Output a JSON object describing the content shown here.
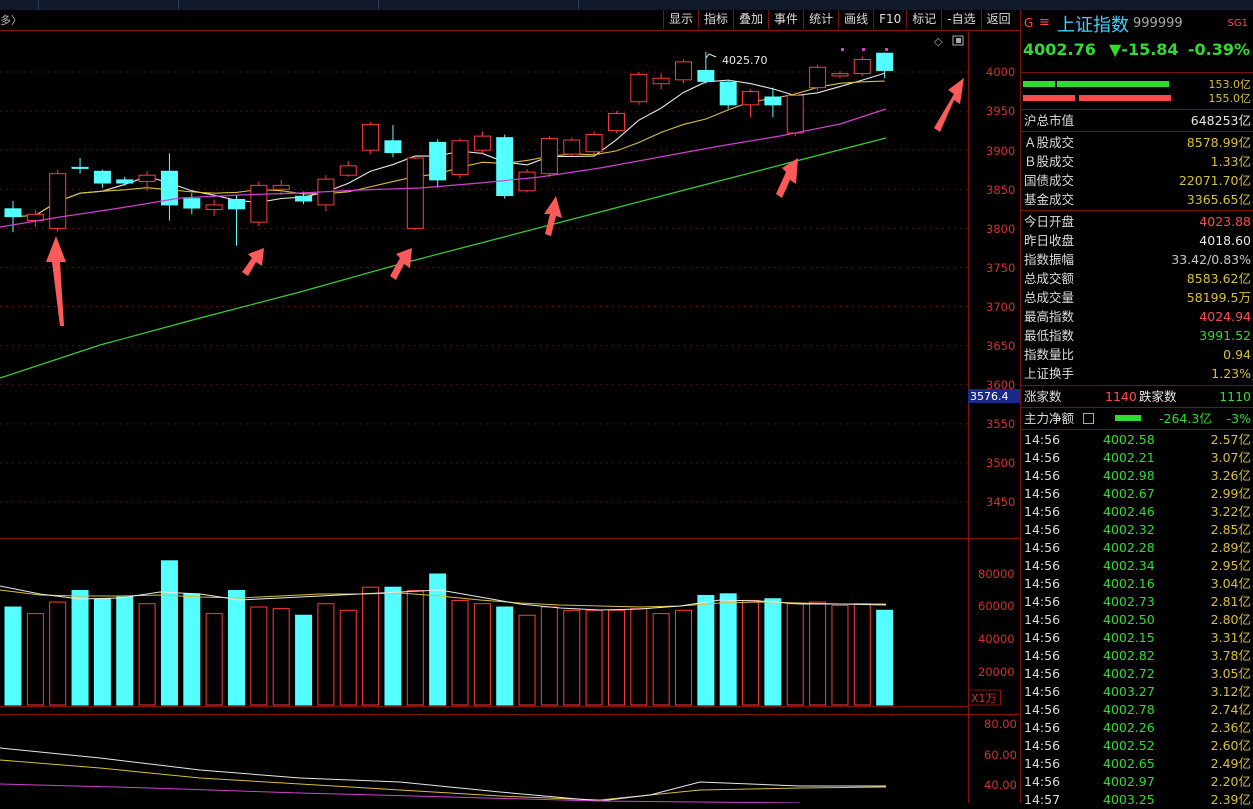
{
  "crumb": "多〉",
  "toolbar": [
    "显示",
    "指标",
    "叠加",
    "事件",
    "统计",
    "画线",
    "F10",
    "标记",
    "-自选",
    "返回"
  ],
  "price_axis": {
    "ticks": [
      "4000",
      "3950",
      "3900",
      "3850",
      "3800",
      "3750",
      "3700",
      "3650",
      "3600",
      "3550",
      "3500",
      "3450"
    ],
    "highlight": "3576.4",
    "peak_label": "4025.70"
  },
  "vol_axis": {
    "ticks": [
      "80000",
      "60000",
      "40000",
      "20000"
    ],
    "unit": "X1万"
  },
  "ind_axis": {
    "ticks": [
      "80.00",
      "60.00",
      "40.00"
    ]
  },
  "chart_data": {
    "type": "candlestick",
    "price_range": [
      3400,
      4060
    ],
    "candles": [
      {
        "o": 3825,
        "c": 3815,
        "h": 3835,
        "l": 3795
      },
      {
        "o": 3810,
        "c": 3818,
        "h": 3824,
        "l": 3802
      },
      {
        "o": 3800,
        "c": 3870,
        "h": 3875,
        "l": 3796
      },
      {
        "o": 3878,
        "c": 3877,
        "h": 3890,
        "l": 3870
      },
      {
        "o": 3873,
        "c": 3858,
        "h": 3875,
        "l": 3852
      },
      {
        "o": 3862,
        "c": 3858,
        "h": 3866,
        "l": 3855
      },
      {
        "o": 3860,
        "c": 3868,
        "h": 3873,
        "l": 3848
      },
      {
        "o": 3873,
        "c": 3830,
        "h": 3896,
        "l": 3810
      },
      {
        "o": 3838,
        "c": 3826,
        "h": 3845,
        "l": 3818
      },
      {
        "o": 3824,
        "c": 3830,
        "h": 3837,
        "l": 3816
      },
      {
        "o": 3837,
        "c": 3825,
        "h": 3842,
        "l": 3778
      },
      {
        "o": 3808,
        "c": 3855,
        "h": 3860,
        "l": 3803
      },
      {
        "o": 3850,
        "c": 3855,
        "h": 3862,
        "l": 3843
      },
      {
        "o": 3841,
        "c": 3835,
        "h": 3847,
        "l": 3831
      },
      {
        "o": 3830,
        "c": 3863,
        "h": 3868,
        "l": 3822
      },
      {
        "o": 3868,
        "c": 3880,
        "h": 3886,
        "l": 3866
      },
      {
        "o": 3900,
        "c": 3933,
        "h": 3936,
        "l": 3895
      },
      {
        "o": 3912,
        "c": 3897,
        "h": 3932,
        "l": 3891
      },
      {
        "o": 3800,
        "c": 3890,
        "h": 3894,
        "l": 3798
      },
      {
        "o": 3910,
        "c": 3862,
        "h": 3914,
        "l": 3852
      },
      {
        "o": 3869,
        "c": 3912,
        "h": 3915,
        "l": 3864
      },
      {
        "o": 3900,
        "c": 3918,
        "h": 3924,
        "l": 3895
      },
      {
        "o": 3916,
        "c": 3842,
        "h": 3920,
        "l": 3838
      },
      {
        "o": 3848,
        "c": 3872,
        "h": 3876,
        "l": 3846
      },
      {
        "o": 3870,
        "c": 3915,
        "h": 3918,
        "l": 3866
      },
      {
        "o": 3895,
        "c": 3913,
        "h": 3916,
        "l": 3892
      },
      {
        "o": 3898,
        "c": 3920,
        "h": 3924,
        "l": 3895
      },
      {
        "o": 3925,
        "c": 3947,
        "h": 3950,
        "l": 3922
      },
      {
        "o": 3962,
        "c": 3997,
        "h": 4000,
        "l": 3958
      },
      {
        "o": 3985,
        "c": 3992,
        "h": 3998,
        "l": 3978
      },
      {
        "o": 3990,
        "c": 4013,
        "h": 4016,
        "l": 3986
      },
      {
        "o": 4002,
        "c": 3988,
        "h": 4026,
        "l": 3985
      },
      {
        "o": 3987,
        "c": 3958,
        "h": 3990,
        "l": 3953
      },
      {
        "o": 3958,
        "c": 3975,
        "h": 3978,
        "l": 3942
      },
      {
        "o": 3968,
        "c": 3958,
        "h": 3980,
        "l": 3942
      },
      {
        "o": 3922,
        "c": 3970,
        "h": 3974,
        "l": 3918
      },
      {
        "o": 3980,
        "c": 4006,
        "h": 4009,
        "l": 3976
      },
      {
        "o": 3995,
        "c": 3998,
        "h": 4001,
        "l": 3992
      },
      {
        "o": 3998,
        "c": 4016,
        "h": 4020,
        "l": 3995
      },
      {
        "o": 4024,
        "c": 4002,
        "h": 4025,
        "l": 3992
      }
    ],
    "volume_range": [
      0,
      100000
    ],
    "volumes": [
      60000,
      56000,
      63000,
      70000,
      65000,
      66000,
      62000,
      88000,
      68000,
      56000,
      70000,
      60000,
      59000,
      55000,
      62000,
      58000,
      72000,
      72000,
      70000,
      80000,
      64000,
      62000,
      60000,
      55000,
      60000,
      58000,
      58000,
      58000,
      59000,
      56000,
      58000,
      67000,
      68000,
      64000,
      65000,
      62000,
      63000,
      61000,
      62000,
      58000
    ]
  },
  "panel": {
    "logo": "G",
    "separator": "≡",
    "name": "上证指数",
    "code": "999999",
    "badge": "SG1",
    "price": "4002.76",
    "change": "▼-15.84",
    "pct": "-0.39%",
    "bar1": "153.0亿",
    "bar2": "155.0亿",
    "rows1": [
      {
        "label": "沪总市值",
        "value": "648253亿"
      }
    ],
    "rows2": [
      {
        "label": "Ａ股成交",
        "value": "8578.99亿"
      },
      {
        "label": "Ｂ股成交",
        "value": "1.33亿"
      },
      {
        "label": "国债成交",
        "value": "22071.70亿"
      },
      {
        "label": "基金成交",
        "value": "3365.65亿"
      }
    ],
    "rows3": [
      {
        "label": "今日开盘",
        "value": "4023.88",
        "color": "#ff4a4a"
      },
      {
        "label": "昨日收盘",
        "value": "4018.60",
        "color": "#e8e8e8"
      },
      {
        "label": "指数振幅",
        "value": "33.42/0.83%",
        "color": "#c8c8c8"
      },
      {
        "label": "总成交额",
        "value": "8583.62亿",
        "color": "#d8c038"
      },
      {
        "label": "总成交量",
        "value": "58199.5万",
        "color": "#d8c038"
      },
      {
        "label": "最高指数",
        "value": "4024.94",
        "color": "#ff4a4a"
      },
      {
        "label": "最低指数",
        "value": "3991.52",
        "color": "#2fdc2f"
      },
      {
        "label": "指数量比",
        "value": "0.94",
        "color": "#d8c038"
      },
      {
        "label": "上证换手",
        "value": "1.23%",
        "color": "#d8c038"
      }
    ],
    "adv_label": "涨家数",
    "adv_value": "1140",
    "dec_label": "跌家数",
    "dec_value": "1110",
    "flow_label": "主力净额",
    "flow_value": "-264.3亿",
    "flow_pct": "-3%",
    "ticks": [
      {
        "t": "14:56",
        "p": "4002.58",
        "v": "2.57亿"
      },
      {
        "t": "14:56",
        "p": "4002.21",
        "v": "3.07亿"
      },
      {
        "t": "14:56",
        "p": "4002.98",
        "v": "3.26亿"
      },
      {
        "t": "14:56",
        "p": "4002.67",
        "v": "2.99亿"
      },
      {
        "t": "14:56",
        "p": "4002.46",
        "v": "3.22亿"
      },
      {
        "t": "14:56",
        "p": "4002.32",
        "v": "2.85亿"
      },
      {
        "t": "14:56",
        "p": "4002.28",
        "v": "2.89亿"
      },
      {
        "t": "14:56",
        "p": "4002.34",
        "v": "2.95亿"
      },
      {
        "t": "14:56",
        "p": "4002.16",
        "v": "3.04亿"
      },
      {
        "t": "14:56",
        "p": "4002.73",
        "v": "2.81亿"
      },
      {
        "t": "14:56",
        "p": "4002.50",
        "v": "2.80亿"
      },
      {
        "t": "14:56",
        "p": "4002.15",
        "v": "3.31亿"
      },
      {
        "t": "14:56",
        "p": "4002.82",
        "v": "3.78亿"
      },
      {
        "t": "14:56",
        "p": "4002.72",
        "v": "3.05亿"
      },
      {
        "t": "14:56",
        "p": "4003.27",
        "v": "3.12亿"
      },
      {
        "t": "14:56",
        "p": "4002.78",
        "v": "2.74亿"
      },
      {
        "t": "14:56",
        "p": "4002.26",
        "v": "2.36亿"
      },
      {
        "t": "14:56",
        "p": "4002.52",
        "v": "2.60亿"
      },
      {
        "t": "14:56",
        "p": "4002.65",
        "v": "2.49亿"
      },
      {
        "t": "14:56",
        "p": "4002.97",
        "v": "2.20亿"
      },
      {
        "t": "14:57",
        "p": "4003.25",
        "v": "2.39亿"
      }
    ]
  }
}
